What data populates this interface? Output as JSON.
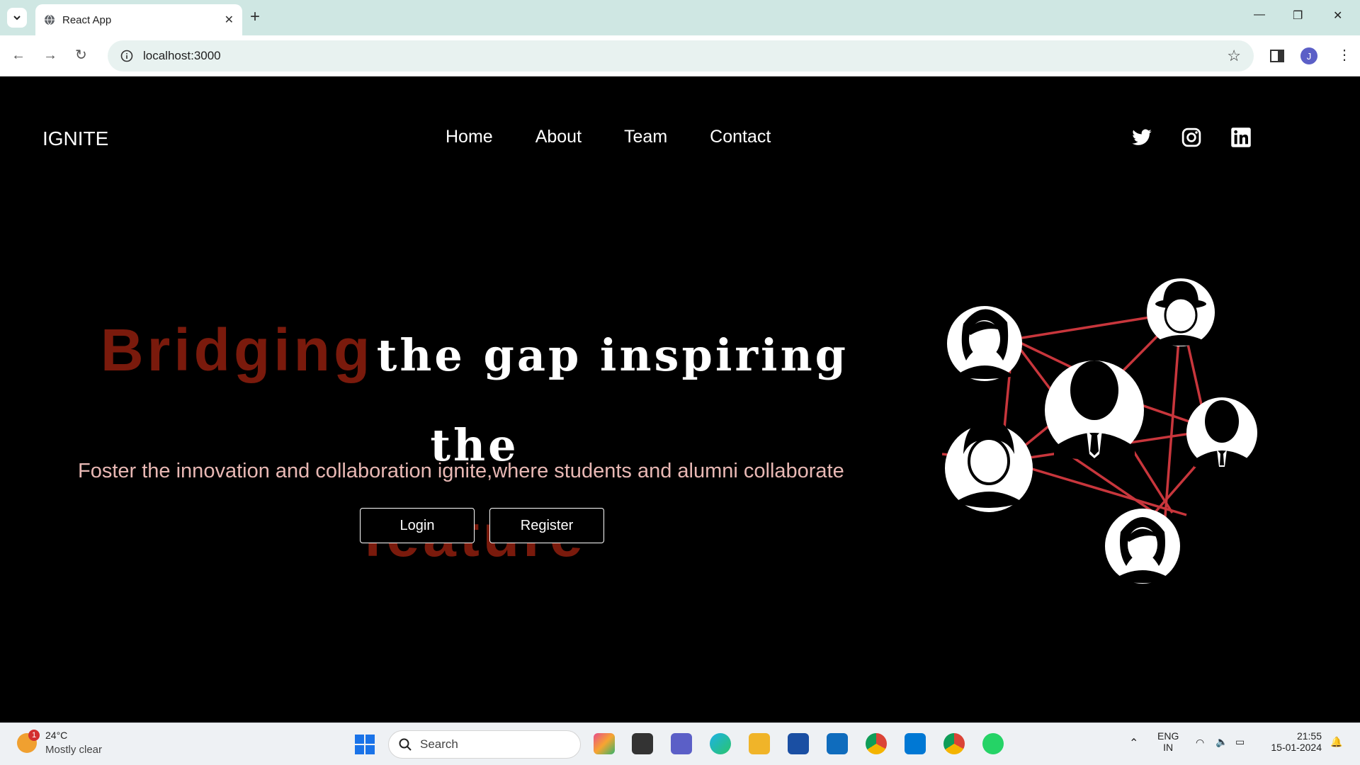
{
  "browser": {
    "tab_title": "React App",
    "url": "localhost:3000",
    "profile_initial": "J"
  },
  "page": {
    "brand": "IGNITE",
    "nav": [
      "Home",
      "About",
      "Team",
      "Contact"
    ],
    "social": [
      "twitter-icon",
      "instagram-icon",
      "linkedin-icon"
    ],
    "headline": {
      "word1": "Bridging",
      "middle": "the gap inspiring the",
      "word2": "feature"
    },
    "tagline": "Foster the innovation and collaboration ignite,where students and alumni collaborate",
    "buttons": {
      "login": "Login",
      "register": "Register"
    },
    "colors": {
      "accent": "#7a1a0c",
      "tagline": "#e8b8b4",
      "network_lines": "#c8363c"
    }
  },
  "taskbar": {
    "weather": {
      "temp": "24°C",
      "desc": "Mostly clear",
      "badge": "1"
    },
    "search_placeholder": "Search",
    "lang": {
      "line1": "ENG",
      "line2": "IN"
    },
    "time": "21:55",
    "date": "15-01-2024"
  }
}
